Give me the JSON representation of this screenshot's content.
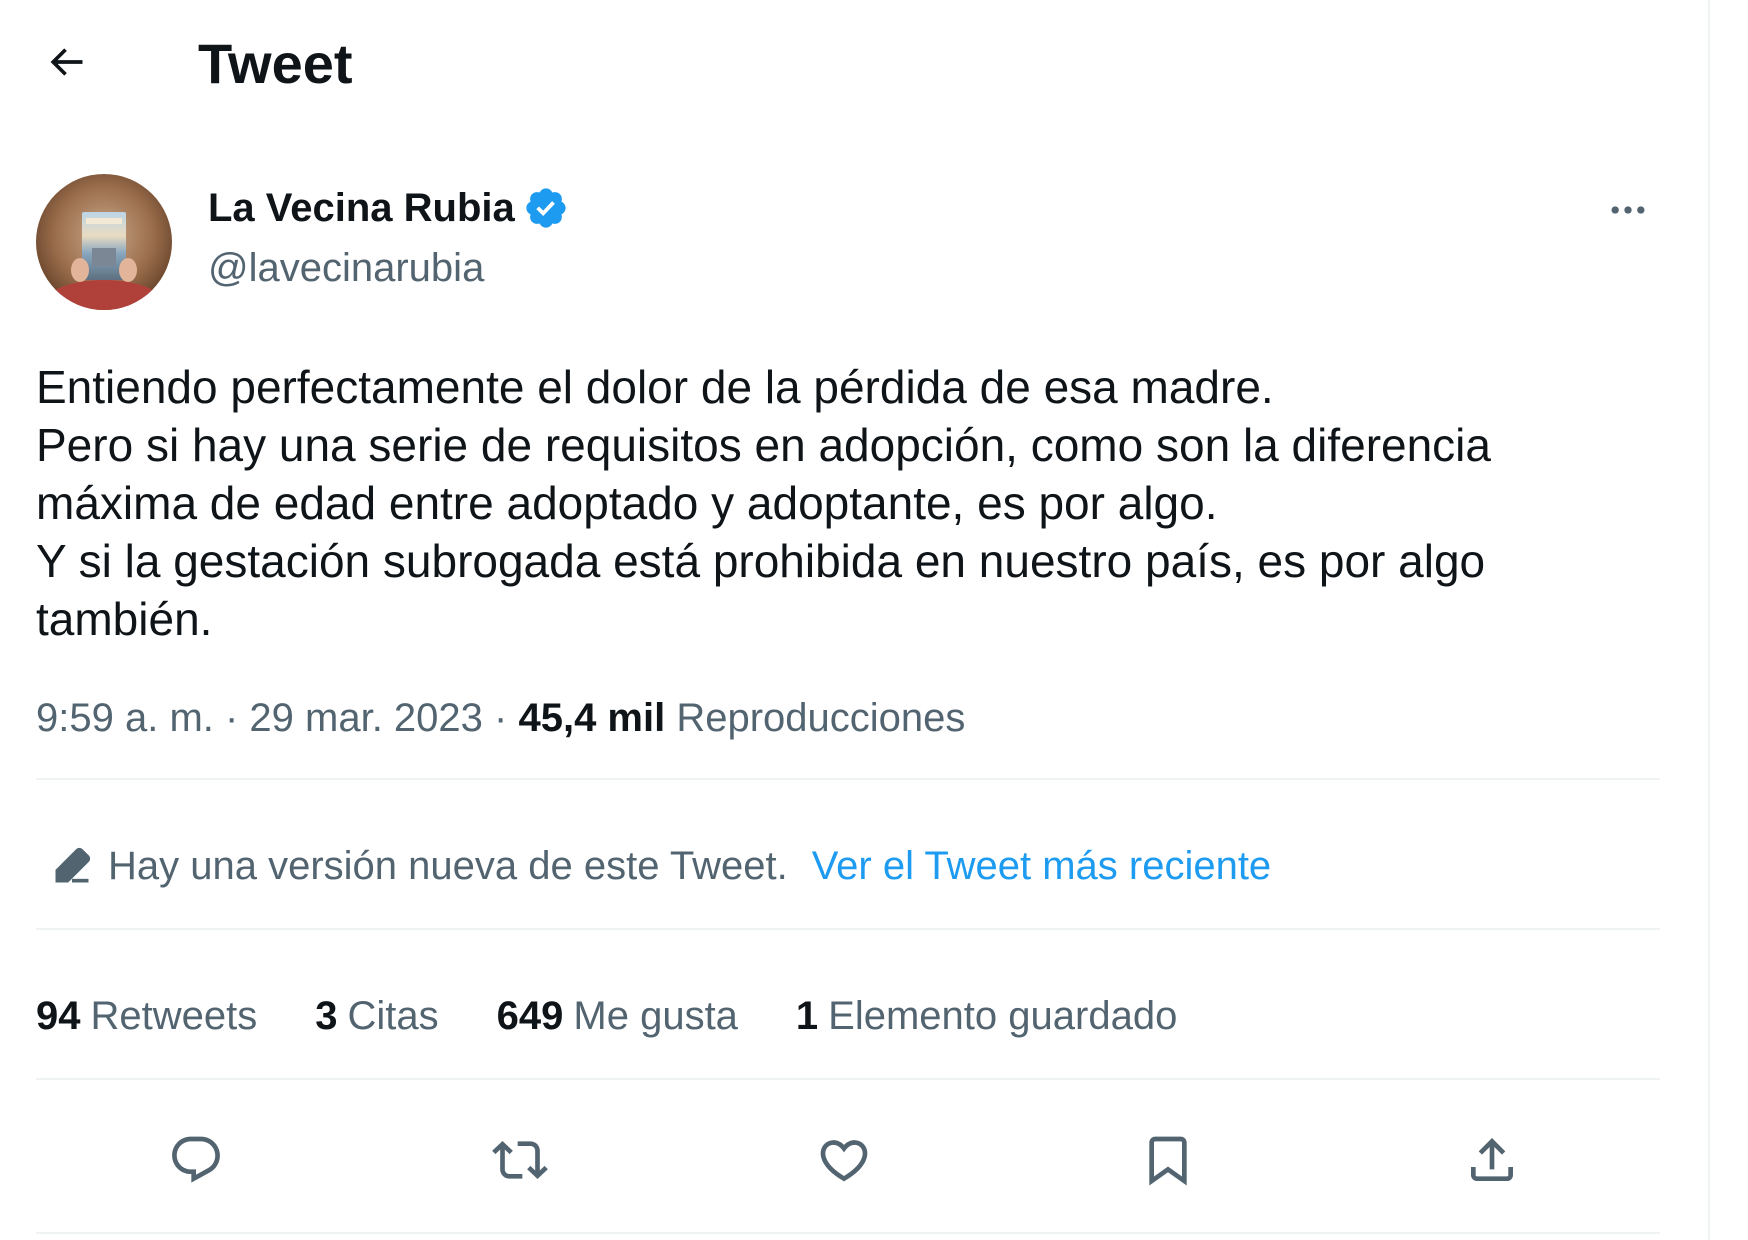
{
  "header": {
    "back_icon": "arrow-left-icon",
    "title": "Tweet"
  },
  "author": {
    "name": "La Vecina Rubia",
    "handle": "@lavecinarubia",
    "verified_icon": "verified-badge-icon",
    "verified_color": "#1d9bf0"
  },
  "more_icon": "more-horizontal-icon",
  "tweet": {
    "lines": [
      "Entiendo perfectamente el dolor de la pérdida de esa madre.",
      "Pero si hay una serie de requisitos en adopción, como son la diferencia",
      "máxima de edad entre adoptado y adoptante, es por algo.",
      "Y si la gestación subrogada está prohibida en nuestro país, es por algo",
      "también."
    ]
  },
  "meta": {
    "time": "9:59 a. m.",
    "separator": " · ",
    "date": "29 mar. 2023",
    "views_count": "45,4 mil",
    "views_label": "Reproducciones"
  },
  "edited_notice": {
    "icon": "pencil-icon",
    "text": "Hay una versión nueva de este Tweet.",
    "link": "Ver el Tweet más reciente"
  },
  "stats": [
    {
      "count": "94",
      "label": "Retweets"
    },
    {
      "count": "3",
      "label": "Citas"
    },
    {
      "count": "649",
      "label": "Me gusta"
    },
    {
      "count": "1",
      "label": "Elemento guardado"
    }
  ],
  "actions": [
    {
      "name": "reply",
      "icon": "reply-icon"
    },
    {
      "name": "retweet",
      "icon": "retweet-icon"
    },
    {
      "name": "like",
      "icon": "heart-icon"
    },
    {
      "name": "bookmark",
      "icon": "bookmark-icon"
    },
    {
      "name": "share",
      "icon": "share-icon"
    }
  ],
  "colors": {
    "text_primary": "#0f1419",
    "text_secondary": "#536471",
    "accent": "#1d9bf0",
    "divider": "#eff3f4"
  }
}
